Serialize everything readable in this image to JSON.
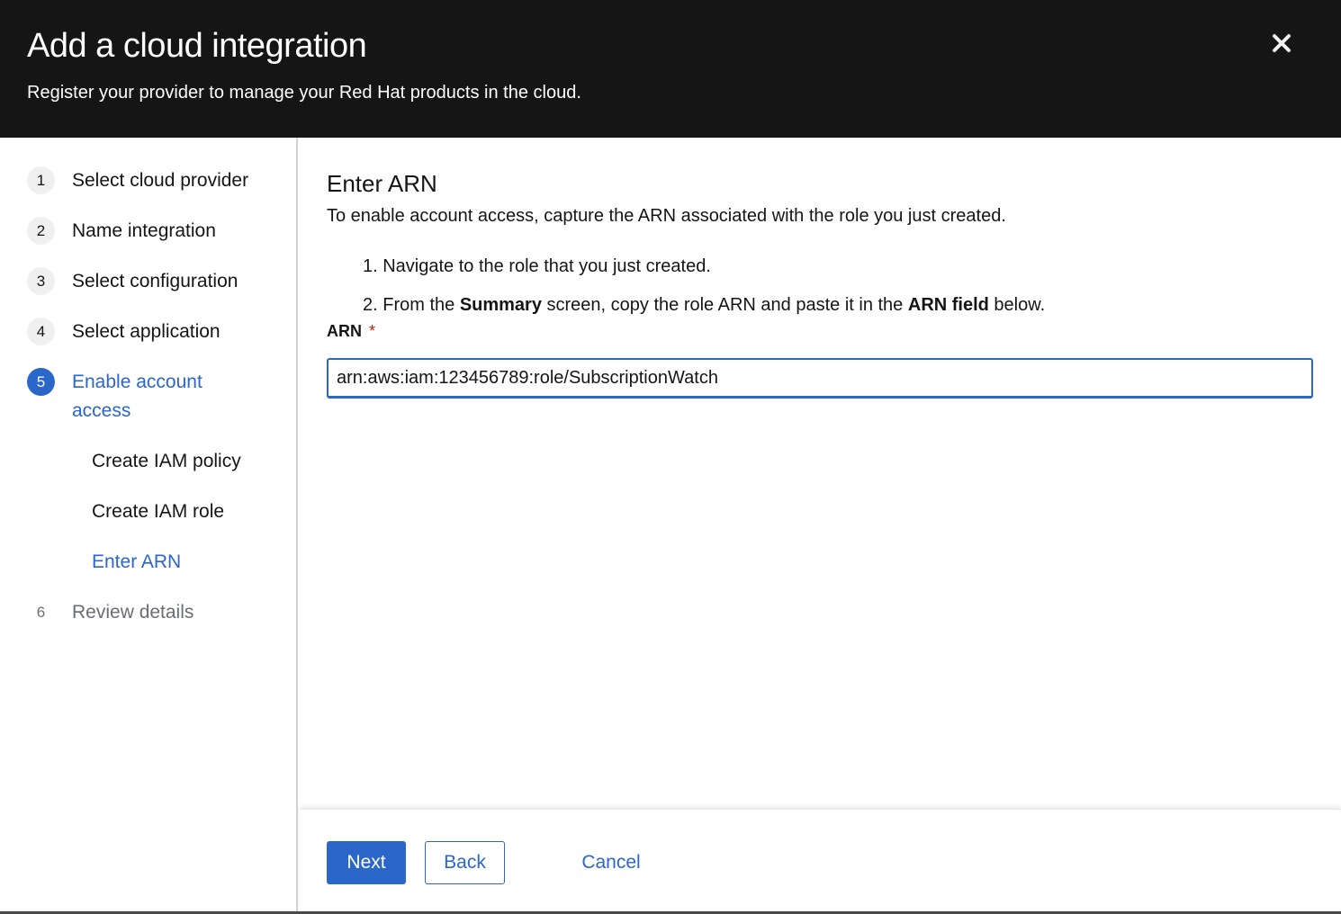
{
  "header": {
    "title": "Add a cloud integration",
    "subtitle": "Register your provider to manage your Red Hat products in the cloud.",
    "close_icon": "close-icon"
  },
  "wizard_nav": {
    "steps": [
      {
        "number": "1",
        "label": "Select cloud provider",
        "state": "visited"
      },
      {
        "number": "2",
        "label": "Name integration",
        "state": "visited"
      },
      {
        "number": "3",
        "label": "Select configuration",
        "state": "visited"
      },
      {
        "number": "4",
        "label": "Select application",
        "state": "visited"
      },
      {
        "number": "5",
        "label": "Enable account access",
        "state": "current",
        "substeps": [
          {
            "label": "Create IAM policy",
            "state": "visited"
          },
          {
            "label": "Create IAM role",
            "state": "visited"
          },
          {
            "label": "Enter ARN",
            "state": "current"
          }
        ]
      },
      {
        "number": "6",
        "label": "Review details",
        "state": "disabled"
      }
    ]
  },
  "main": {
    "heading": "Enter ARN",
    "description": "To enable account access, capture the ARN associated with the role you just created.",
    "instructions": [
      {
        "prefix": "1. Navigate to the role that you just created.",
        "parts": []
      },
      {
        "parts": [
          "2. From the ",
          "Summary",
          " screen, copy the role ARN and paste it in the ",
          "ARN field",
          " below."
        ]
      }
    ],
    "arn_field": {
      "label": "ARN",
      "required_marker": "*",
      "value": "arn:aws:iam:123456789:role/SubscriptionWatch"
    }
  },
  "footer": {
    "next_label": "Next",
    "back_label": "Back",
    "cancel_label": "Cancel"
  },
  "colors": {
    "header_bg": "#151515",
    "primary": "#2b66c9",
    "required": "#c9190b",
    "disabled_text": "#6a6e73"
  }
}
